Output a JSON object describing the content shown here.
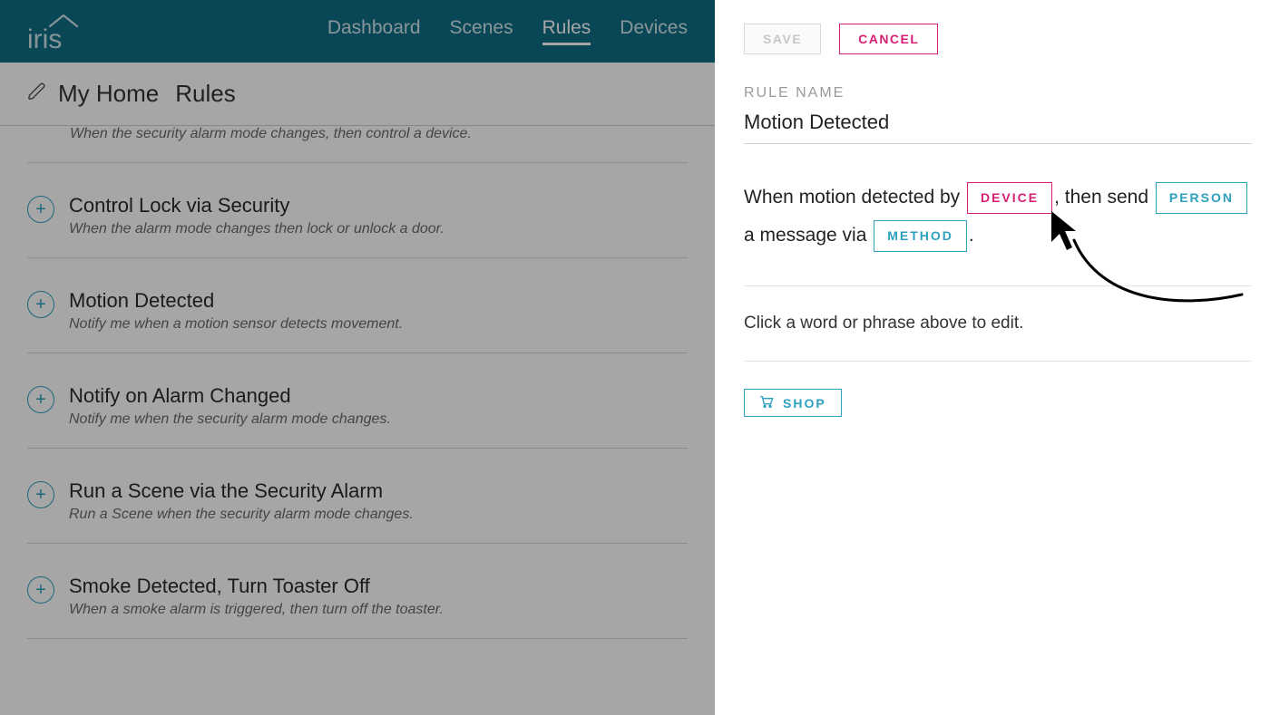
{
  "nav": {
    "items": [
      "Dashboard",
      "Scenes",
      "Rules",
      "Devices"
    ],
    "active": "Rules"
  },
  "subheader": {
    "home": "My Home",
    "section": "Rules"
  },
  "rules": {
    "cutDescription": "When the security alarm mode changes, then control a device.",
    "items": [
      {
        "title": "Control Lock via Security",
        "desc": "When the alarm mode changes then lock or unlock a door."
      },
      {
        "title": "Motion Detected",
        "desc": "Notify me when a motion sensor detects movement."
      },
      {
        "title": "Notify on Alarm Changed",
        "desc": "Notify me when the security alarm mode changes."
      },
      {
        "title": "Run a Scene via the Security Alarm",
        "desc": "Run a Scene when the security alarm mode changes."
      },
      {
        "title": "Smoke Detected, Turn Toaster Off",
        "desc": "When a smoke alarm is triggered, then turn off the toaster."
      }
    ]
  },
  "panel": {
    "saveLabel": "SAVE",
    "cancelLabel": "CANCEL",
    "ruleNameLabel": "RULE NAME",
    "ruleNameValue": "Motion Detected",
    "sentenceParts": {
      "p1": "When motion detected by",
      "device": "DEVICE",
      "p2": ", then send",
      "person": "PERSON",
      "p3": "a message via",
      "method": "METHOD",
      "p4": "."
    },
    "hint": "Click a word or phrase above to edit.",
    "shopLabel": "SHOP"
  }
}
